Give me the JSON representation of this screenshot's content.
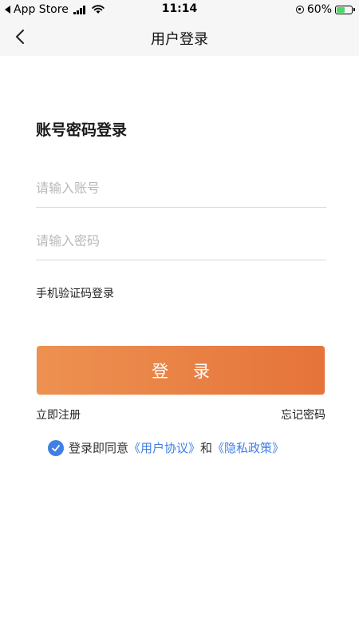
{
  "status_bar": {
    "carrier_back": "App Store",
    "time": "11:14",
    "battery": "60%",
    "battery_level": 0.6,
    "battery_color": "#4cd964"
  },
  "nav": {
    "title": "用户登录",
    "back_icon": "chevron-left-icon"
  },
  "login": {
    "heading": "账号密码登录",
    "account_placeholder": "请输入账号",
    "password_placeholder": "请输入密码",
    "sms_login": "手机验证码登录",
    "submit_label": "登 录",
    "register": "立即注册",
    "forgot": "忘记密码"
  },
  "agreement": {
    "checked": true,
    "prefix": "登录即同意",
    "user_agreement": "《用户协议》",
    "conjunction": "和",
    "privacy_policy": "《隐私政策》",
    "link_color": "#3f7fe6"
  },
  "colors": {
    "button_start": "#ed9151",
    "button_end": "#e5733a",
    "header_bg": "#f6f6f6"
  }
}
